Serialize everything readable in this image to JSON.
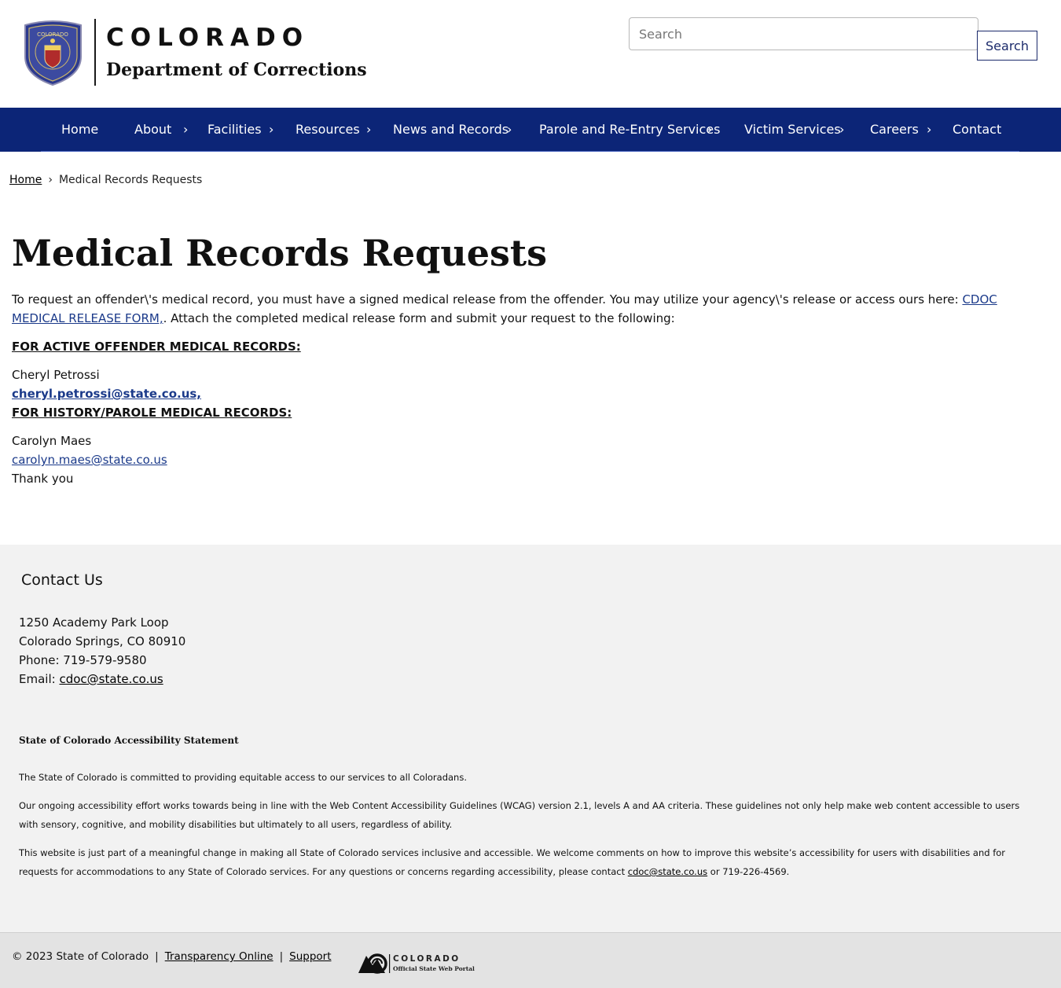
{
  "header": {
    "brand_state": "COLORADO",
    "brand_dept": "Department of Corrections",
    "search_placeholder": "Search",
    "search_button": "Search"
  },
  "nav": {
    "items": [
      {
        "label": "Home",
        "has_submenu": false
      },
      {
        "label": "About",
        "has_submenu": true
      },
      {
        "label": "Facilities",
        "has_submenu": true
      },
      {
        "label": "Resources",
        "has_submenu": true
      },
      {
        "label": "News and Records",
        "has_submenu": true
      },
      {
        "label": "Parole and Re-Entry Services",
        "has_submenu": true
      },
      {
        "label": "Victim Services",
        "has_submenu": true
      },
      {
        "label": "Careers",
        "has_submenu": true
      },
      {
        "label": "Contact",
        "has_submenu": false
      }
    ],
    "chevron": "›"
  },
  "breadcrumb": {
    "home": "Home",
    "separator": "›",
    "current": "Medical Records Requests"
  },
  "main": {
    "title": "Medical Records Requests",
    "intro_before": "To request an offender\\'s medical record, you must have a signed medical release from the offender. You may utilize your agency\\'s release or access ours here: ",
    "intro_link": "CDOC MEDICAL RELEASE FORM,",
    "intro_after": ". Attach the completed medical release form and submit your request to the following:",
    "active_heading": "FOR ACTIVE OFFENDER MEDICAL RECORDS:",
    "active_name": "Cheryl Petrossi",
    "active_email": "cheryl.petrossi@state.co.us,",
    "history_heading": "FOR HISTORY/PAROLE MEDICAL RECORDS:",
    "history_name": "Carolyn Maes",
    "history_email": "carolyn.maes@state.co.us",
    "closing": "Thank you"
  },
  "footer": {
    "contact_title": "Contact Us",
    "address1": "1250 Academy Park Loop",
    "address2": "Colorado Springs, CO 80910",
    "phone": "Phone: 719-579-9580",
    "email_label": "Email: ",
    "email": "cdoc@state.co.us",
    "accessibility_title": "State of Colorado Accessibility Statement",
    "acc_p1": "The State of Colorado is committed to providing equitable access to our services to all Coloradans.",
    "acc_p2": "Our ongoing accessibility effort works towards being in line with the Web Content Accessibility Guidelines (WCAG) version 2.1, levels A and AA criteria. These guidelines not only help make web content accessible to users with sensory, cognitive, and mobility disabilities but ultimately to all users, regardless of ability.",
    "acc_p3_before": "This website is just part of a meaningful change in making all State of Colorado services inclusive and accessible. We welcome comments on how to improve this website’s accessibility for users with disabilities and for requests for accommodations to any State of Colorado services. For any questions or concerns regarding accessibility, please contact ",
    "acc_p3_email": "cdoc@state.co.us",
    "acc_p3_after": " or 719-226-4569."
  },
  "bottom": {
    "copyright": "© 2023 State of Colorado",
    "pipe": "|",
    "transparency": "Transparency Online",
    "support": "Support",
    "logo_word": "COLORADO",
    "logo_sub": "Official State Web Portal"
  },
  "colors": {
    "nav_bg": "#0c2577",
    "link": "#1b3a8a",
    "footer_bg": "#f2f2f2",
    "bottom_bg": "#e3e3e3"
  }
}
